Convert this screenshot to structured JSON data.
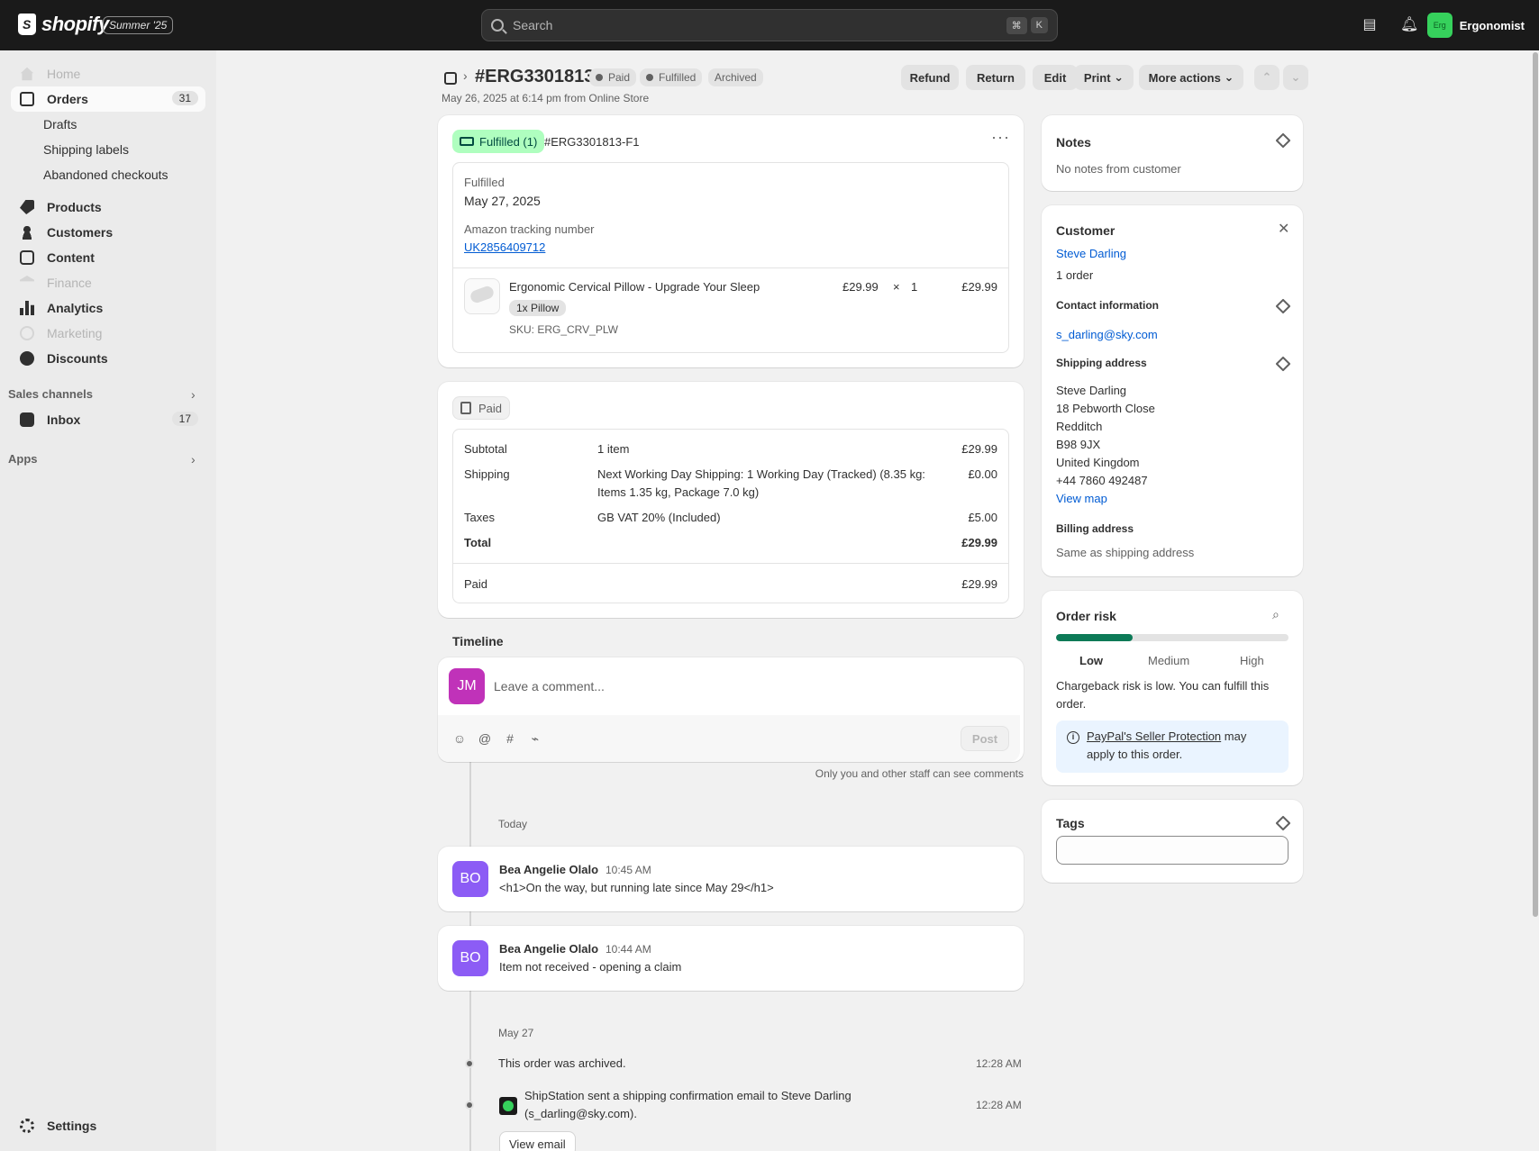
{
  "topbar": {
    "brand": "shopify",
    "promo_badge": "Summer '25",
    "search_placeholder": "Search",
    "shortcut_keys": [
      "⌘",
      "K"
    ],
    "store_initials": "Erg",
    "store_name": "Ergonomist"
  },
  "sidebar": {
    "home": "Home",
    "orders": "Orders",
    "orders_count": "31",
    "drafts": "Drafts",
    "shipping_labels": "Shipping labels",
    "abandoned_checkouts": "Abandoned checkouts",
    "products": "Products",
    "customers": "Customers",
    "content": "Content",
    "finance": "Finance",
    "analytics": "Analytics",
    "marketing": "Marketing",
    "discounts": "Discounts",
    "sales_channels": "Sales channels",
    "inbox": "Inbox",
    "inbox_count": "17",
    "apps": "Apps",
    "settings": "Settings"
  },
  "header": {
    "order_number": "#ERG3301813",
    "badges": [
      "Paid",
      "Fulfilled",
      "Archived"
    ],
    "meta": "May 26, 2025 at 6:14 pm from Online Store",
    "actions": {
      "refund": "Refund",
      "return": "Return",
      "edit": "Edit",
      "print": "Print",
      "more_actions": "More actions"
    }
  },
  "fulfillment": {
    "status_badge": "Fulfilled (1)",
    "fulfillment_id": "#ERG3301813-F1",
    "status_label": "Fulfilled",
    "date": "May 27, 2025",
    "tracking_label": "Amazon tracking number",
    "tracking_number": "UK2856409712",
    "item": {
      "title": "Ergonomic Cervical Pillow - Upgrade Your Sleep",
      "variant": "1x Pillow",
      "sku": "SKU: ERG_CRV_PLW",
      "unit_price": "£29.99",
      "times": "×",
      "quantity": "1",
      "line_total": "£29.99"
    }
  },
  "payment": {
    "status_badge": "Paid",
    "rows": {
      "subtotal_label": "Subtotal",
      "subtotal_desc": "1 item",
      "subtotal_value": "£29.99",
      "shipping_label": "Shipping",
      "shipping_desc_1": "Next Working Day Shipping: 1 Working Day (Tracked) (8.35 kg:",
      "shipping_desc_2": "Items 1.35 kg, Package 7.0 kg)",
      "shipping_value": "£0.00",
      "taxes_label": "Taxes",
      "taxes_desc": "GB VAT 20% (Included)",
      "taxes_value": "£5.00",
      "total_label": "Total",
      "total_value": "£29.99",
      "paid_label": "Paid",
      "paid_value": "£29.99"
    }
  },
  "timeline": {
    "title": "Timeline",
    "user_initials": "JM",
    "comment_placeholder": "Leave a comment...",
    "post_label": "Post",
    "staff_note": "Only you and other staff can see comments",
    "today_label": "Today",
    "comments": [
      {
        "initials": "BO",
        "author": "Bea Angelie Olalo",
        "time": "10:45 AM",
        "text": "<h1>On the way, but running late since May 29</h1>"
      },
      {
        "initials": "BO",
        "author": "Bea Angelie Olalo",
        "time": "10:44 AM",
        "text": "Item not received - opening a claim"
      }
    ],
    "may27_label": "May 27",
    "events": [
      {
        "text": "This order was archived.",
        "time": "12:28 AM"
      },
      {
        "text_1": "ShipStation sent a shipping confirmation email to Steve Darling",
        "text_2": "(s_darling@sky.com).",
        "time": "12:28 AM"
      }
    ],
    "view_email": "View email"
  },
  "notes": {
    "title": "Notes",
    "text": "No notes from customer"
  },
  "customer": {
    "title": "Customer",
    "name": "Steve Darling",
    "orders": "1 order",
    "contact_title": "Contact information",
    "email": "s_darling@sky.com",
    "shipping_title": "Shipping address",
    "address_lines": [
      "Steve Darling",
      "18 Pebworth Close",
      "Redditch",
      "B98 9JX",
      "United Kingdom",
      "+44 7860 492487"
    ],
    "view_map": "View map",
    "billing_title": "Billing address",
    "billing_text": "Same as shipping address"
  },
  "risk": {
    "title": "Order risk",
    "level_fraction": 0.33,
    "levels": [
      "Low",
      "Medium",
      "High"
    ],
    "summary_1": "Chargeback risk is low. You can fulfill this",
    "summary_2": "order.",
    "protection_link": "PayPal's Seller Protection",
    "protection_rest": " may",
    "protection_line2": "apply to this order.",
    "accent": "#0c7a57"
  },
  "tags": {
    "title": "Tags"
  }
}
